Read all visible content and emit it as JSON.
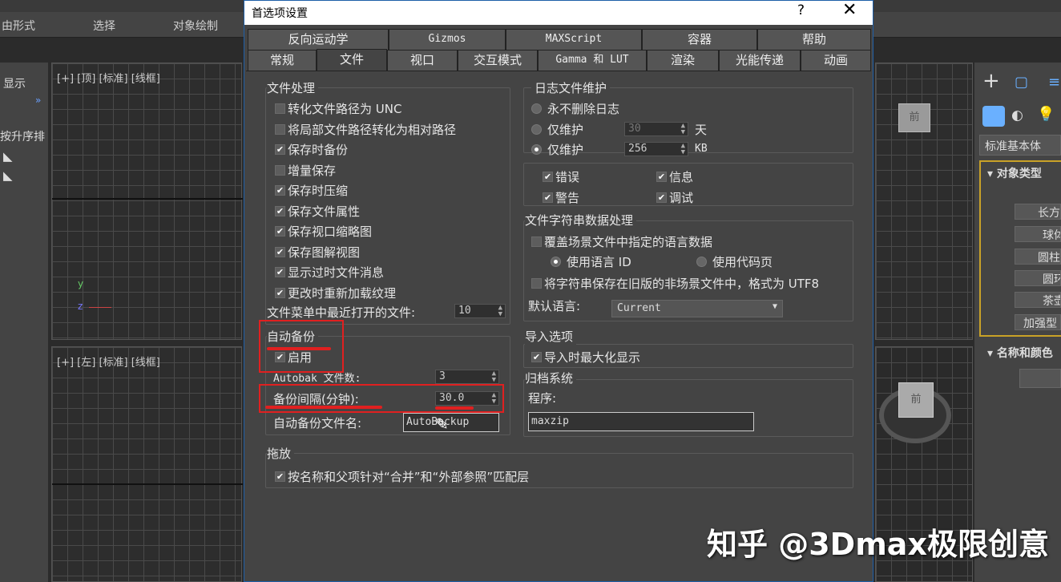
{
  "background": {
    "toolbar_items": [
      "由形式",
      "选择",
      "对象绘制"
    ],
    "left_panel": {
      "display": "显示",
      "sort": "按升序排"
    },
    "viewport_labels": [
      "[+] [顶] [标准] [线框]",
      "[+] [左] [标准] [线框]"
    ],
    "right_panel": {
      "dropdown": "标准基本体",
      "rollout_object_type": "对象类型",
      "object_buttons": [
        "长方",
        "球体",
        "圆柱",
        "圆环",
        "茶壶",
        "加强型"
      ],
      "rollout_name_color": "名称和颜色",
      "viewcube_label": "前",
      "viewcube_top": "前"
    }
  },
  "dialog": {
    "title": "首选项设置",
    "help": "?",
    "close": "✕",
    "tabs_row1": [
      "反向运动学",
      "Gizmos",
      "MAXScript",
      "容器",
      "帮助"
    ],
    "tabs_row2": [
      "常规",
      "文件",
      "视口",
      "交互模式",
      "Gamma 和 LUT",
      "渲染",
      "光能传递",
      "动画"
    ],
    "active_tab": "文件",
    "file_handling": {
      "title": "文件处理",
      "items": [
        {
          "label": "转化文件路径为 UNC",
          "checked": false
        },
        {
          "label": "将局部文件路径转化为相对路径",
          "checked": false
        },
        {
          "label": "保存时备份",
          "checked": true
        },
        {
          "label": "增量保存",
          "checked": false
        },
        {
          "label": "保存时压缩",
          "checked": true
        },
        {
          "label": "保存文件属性",
          "checked": true
        },
        {
          "label": "保存视口缩略图",
          "checked": true
        },
        {
          "label": "保存图解视图",
          "checked": true
        },
        {
          "label": "显示过时文件消息",
          "checked": true
        },
        {
          "label": "更改时重新加载纹理",
          "checked": true
        }
      ],
      "recent_files_label": "文件菜单中最近打开的文件:",
      "recent_files_value": "10"
    },
    "auto_backup": {
      "title": "自动备份",
      "enable_label": "启用",
      "enable_checked": true,
      "count_label": "Autobak 文件数:",
      "count_value": "3",
      "interval_label": "备份间隔(分钟):",
      "interval_value": "30.0",
      "name_label": "自动备份文件名:",
      "name_value": "AutoBackup"
    },
    "drag_drop": {
      "title": "拖放",
      "item_label": "按名称和父项针对“合并”和“外部参照”匹配层",
      "item_checked": true
    },
    "log_maintenance": {
      "title": "日志文件维护",
      "never_delete": "永不删除日志",
      "keep_days_label": "仅维护",
      "keep_days_value": "30",
      "days_unit": "天",
      "keep_kb_label": "仅维护",
      "keep_kb_value": "256",
      "kb_unit": "KB",
      "selected": "kb",
      "checks": [
        {
          "label": "错误",
          "checked": true
        },
        {
          "label": "信息",
          "checked": true
        },
        {
          "label": "警告",
          "checked": true
        },
        {
          "label": "调试",
          "checked": true
        }
      ]
    },
    "string_data": {
      "title": "文件字符串数据处理",
      "override_label": "覆盖场景文件中指定的语言数据",
      "override_checked": false,
      "use_lang_id": "使用语言 ID",
      "use_code_page": "使用代码页",
      "save_legacy_label": "将字符串保存在旧版的非场景文件中，格式为 UTF8",
      "save_legacy_checked": false,
      "default_lang_label": "默认语言:",
      "default_lang_value": "Current"
    },
    "import_options": {
      "title": "导入选项",
      "maximize_label": "导入时最大化显示",
      "maximize_checked": true
    },
    "archive": {
      "title": "归档系统",
      "program_label": "程序:",
      "program_value": "maxzip"
    }
  },
  "watermark": "知乎 @3Dmax极限创意",
  "annotation_color": "#e02020"
}
